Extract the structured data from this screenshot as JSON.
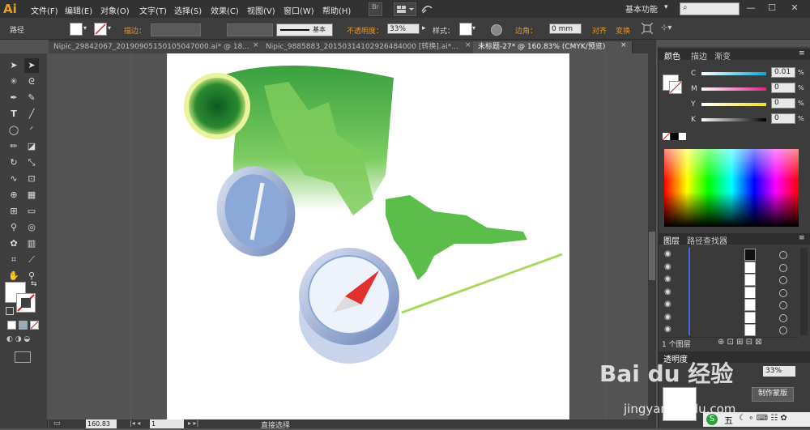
{
  "app": {
    "logo": "Ai"
  },
  "menu": {
    "items": [
      "文件(F)",
      "编辑(E)",
      "对象(O)",
      "文字(T)",
      "选择(S)",
      "效果(C)",
      "视图(V)",
      "窗口(W)",
      "帮助(H)"
    ],
    "br_label": "Br"
  },
  "workspace": {
    "label": "基本功能"
  },
  "control": {
    "object_type": "路径",
    "stroke_label": "描边：",
    "stroke_style": "基本",
    "opacity_label": "不透明度：",
    "opacity_value": "33%",
    "style_label": "样式：",
    "corner_label": "边角：",
    "corner_value": "0 mm",
    "align_label": "对齐",
    "transform_label": "变换"
  },
  "tabs": [
    {
      "label": "Nipic_29842067_20190905150105047000.ai* @ 18..."
    },
    {
      "label": "Nipic_9885883_20150314102926484000 [转换].ai*..."
    },
    {
      "label": "未标题-27* @ 160.83% (CMYK/预览)"
    }
  ],
  "status": {
    "zoom": "160.83",
    "page": "1",
    "tool": "直接选择"
  },
  "color_panel": {
    "tabs": [
      "颜色",
      "描边",
      "渐变"
    ],
    "channels": [
      {
        "label": "C",
        "value": "0.01",
        "color": "#00aadd"
      },
      {
        "label": "M",
        "value": "0",
        "color": "#e0208a"
      },
      {
        "label": "Y",
        "value": "0",
        "color": "#f0e020"
      },
      {
        "label": "K",
        "value": "0",
        "color": "#000000"
      }
    ],
    "unit": "%"
  },
  "layers_panel": {
    "tabs": [
      "图层",
      "路径查找器"
    ],
    "footer": "1 个图层",
    "row_count": 7
  },
  "lower_panel": {
    "tab": "透明度",
    "opacity": "33%",
    "button": "制作蒙版"
  },
  "watermark": {
    "text": "Bai du 经验",
    "url": "jingyan.baidu.com"
  },
  "taskbar": {
    "ime": "五"
  },
  "colors": {
    "map_green": "#5cbe4a",
    "compass_blue": "#8aa8d8",
    "needle_red": "#e03030"
  }
}
